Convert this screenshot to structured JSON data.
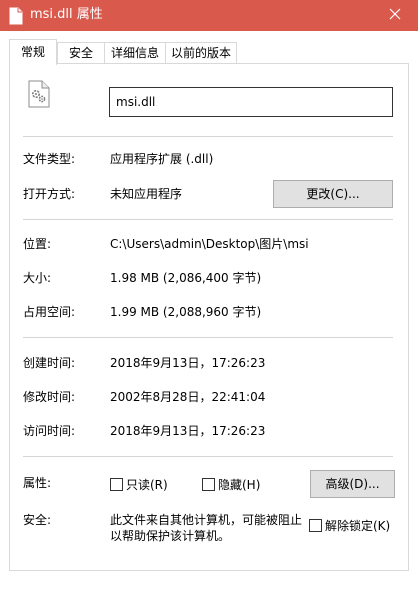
{
  "window": {
    "title": "msi.dll 属性",
    "title_icon": "document-icon",
    "close_icon": "close-icon",
    "title_bar_color": "#d9594c"
  },
  "tabs": [
    {
      "label": "常规",
      "active": true
    },
    {
      "label": "安全",
      "active": false
    },
    {
      "label": "详细信息",
      "active": false
    },
    {
      "label": "以前的版本",
      "active": false
    }
  ],
  "general": {
    "file_icon": "dll-file-gear-icon",
    "filename": "msi.dll",
    "file_type_label": "文件类型:",
    "file_type_value": "应用程序扩展 (.dll)",
    "open_with_label": "打开方式:",
    "open_with_value": "未知应用程序",
    "change_button": "更改(C)...",
    "location_label": "位置:",
    "location_value": "C:\\Users\\admin\\Desktop\\图片\\msi",
    "size_label": "大小:",
    "size_value": "1.98 MB (2,086,400 字节)",
    "size_on_disk_label": "占用空间:",
    "size_on_disk_value": "1.99 MB (2,088,960 字节)",
    "created_label": "创建时间:",
    "created_value": "2018年9月13日，17:26:23",
    "modified_label": "修改时间:",
    "modified_value": "2002年8月28日，22:41:04",
    "accessed_label": "访问时间:",
    "accessed_value": "2018年9月13日，17:26:23",
    "attributes_label": "属性:",
    "readonly_label": "只读(R)",
    "readonly_checked": false,
    "hidden_label": "隐藏(H)",
    "hidden_checked": false,
    "advanced_button": "高级(D)...",
    "security_label": "安全:",
    "security_text_line1": "此文件来自其他计算机，可能被阻止",
    "security_text_line2": "以帮助保护该计算机。",
    "unblock_label": "解除锁定(K)",
    "unblock_checked": false
  }
}
